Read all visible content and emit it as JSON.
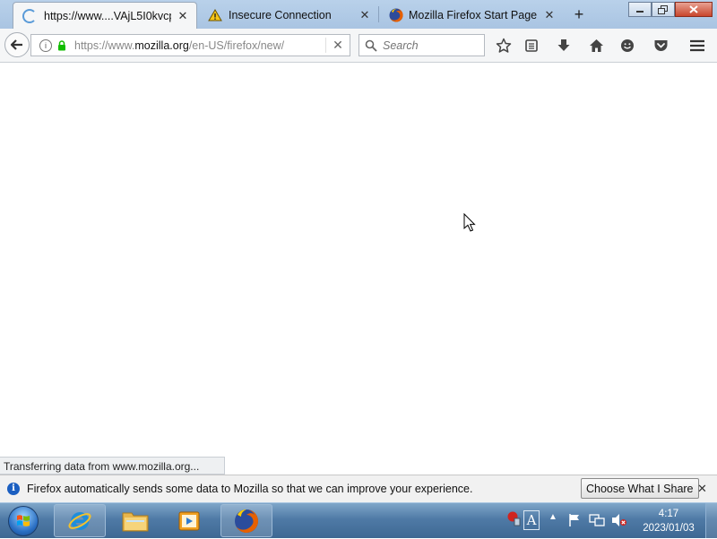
{
  "tabs": [
    {
      "label": "https://www....VAjL5I0kvcp",
      "icon": "loading-spinner-icon",
      "active": true
    },
    {
      "label": "Insecure Connection",
      "icon": "warning-icon",
      "active": false
    },
    {
      "label": "Mozilla Firefox Start Page",
      "icon": "firefox-icon",
      "active": false
    }
  ],
  "tab_close_glyph": "✕",
  "new_tab_glyph": "+",
  "urlbar": {
    "prefix": "https://www.",
    "host": "mozilla.org",
    "path": "/en-US/firefox/new/"
  },
  "search": {
    "placeholder": "Search"
  },
  "status_text": "Transferring data from www.mozilla.org...",
  "notification": {
    "message": "Firefox automatically sends some data to Mozilla so that we can improve your experience.",
    "button_label": "Choose What I Share"
  },
  "taskbar": {
    "apps": [
      "internet-explorer-icon",
      "file-explorer-icon",
      "media-player-icon",
      "firefox-icon"
    ],
    "clock_time": "4:17",
    "clock_date": "2023/01/03",
    "language_indicator": "A"
  },
  "colors": {
    "tabstrip": "#b9d1ea",
    "toolbar": "#f5f6f7",
    "lock_green": "#12bc00",
    "info_blue": "#1b5fc1"
  }
}
